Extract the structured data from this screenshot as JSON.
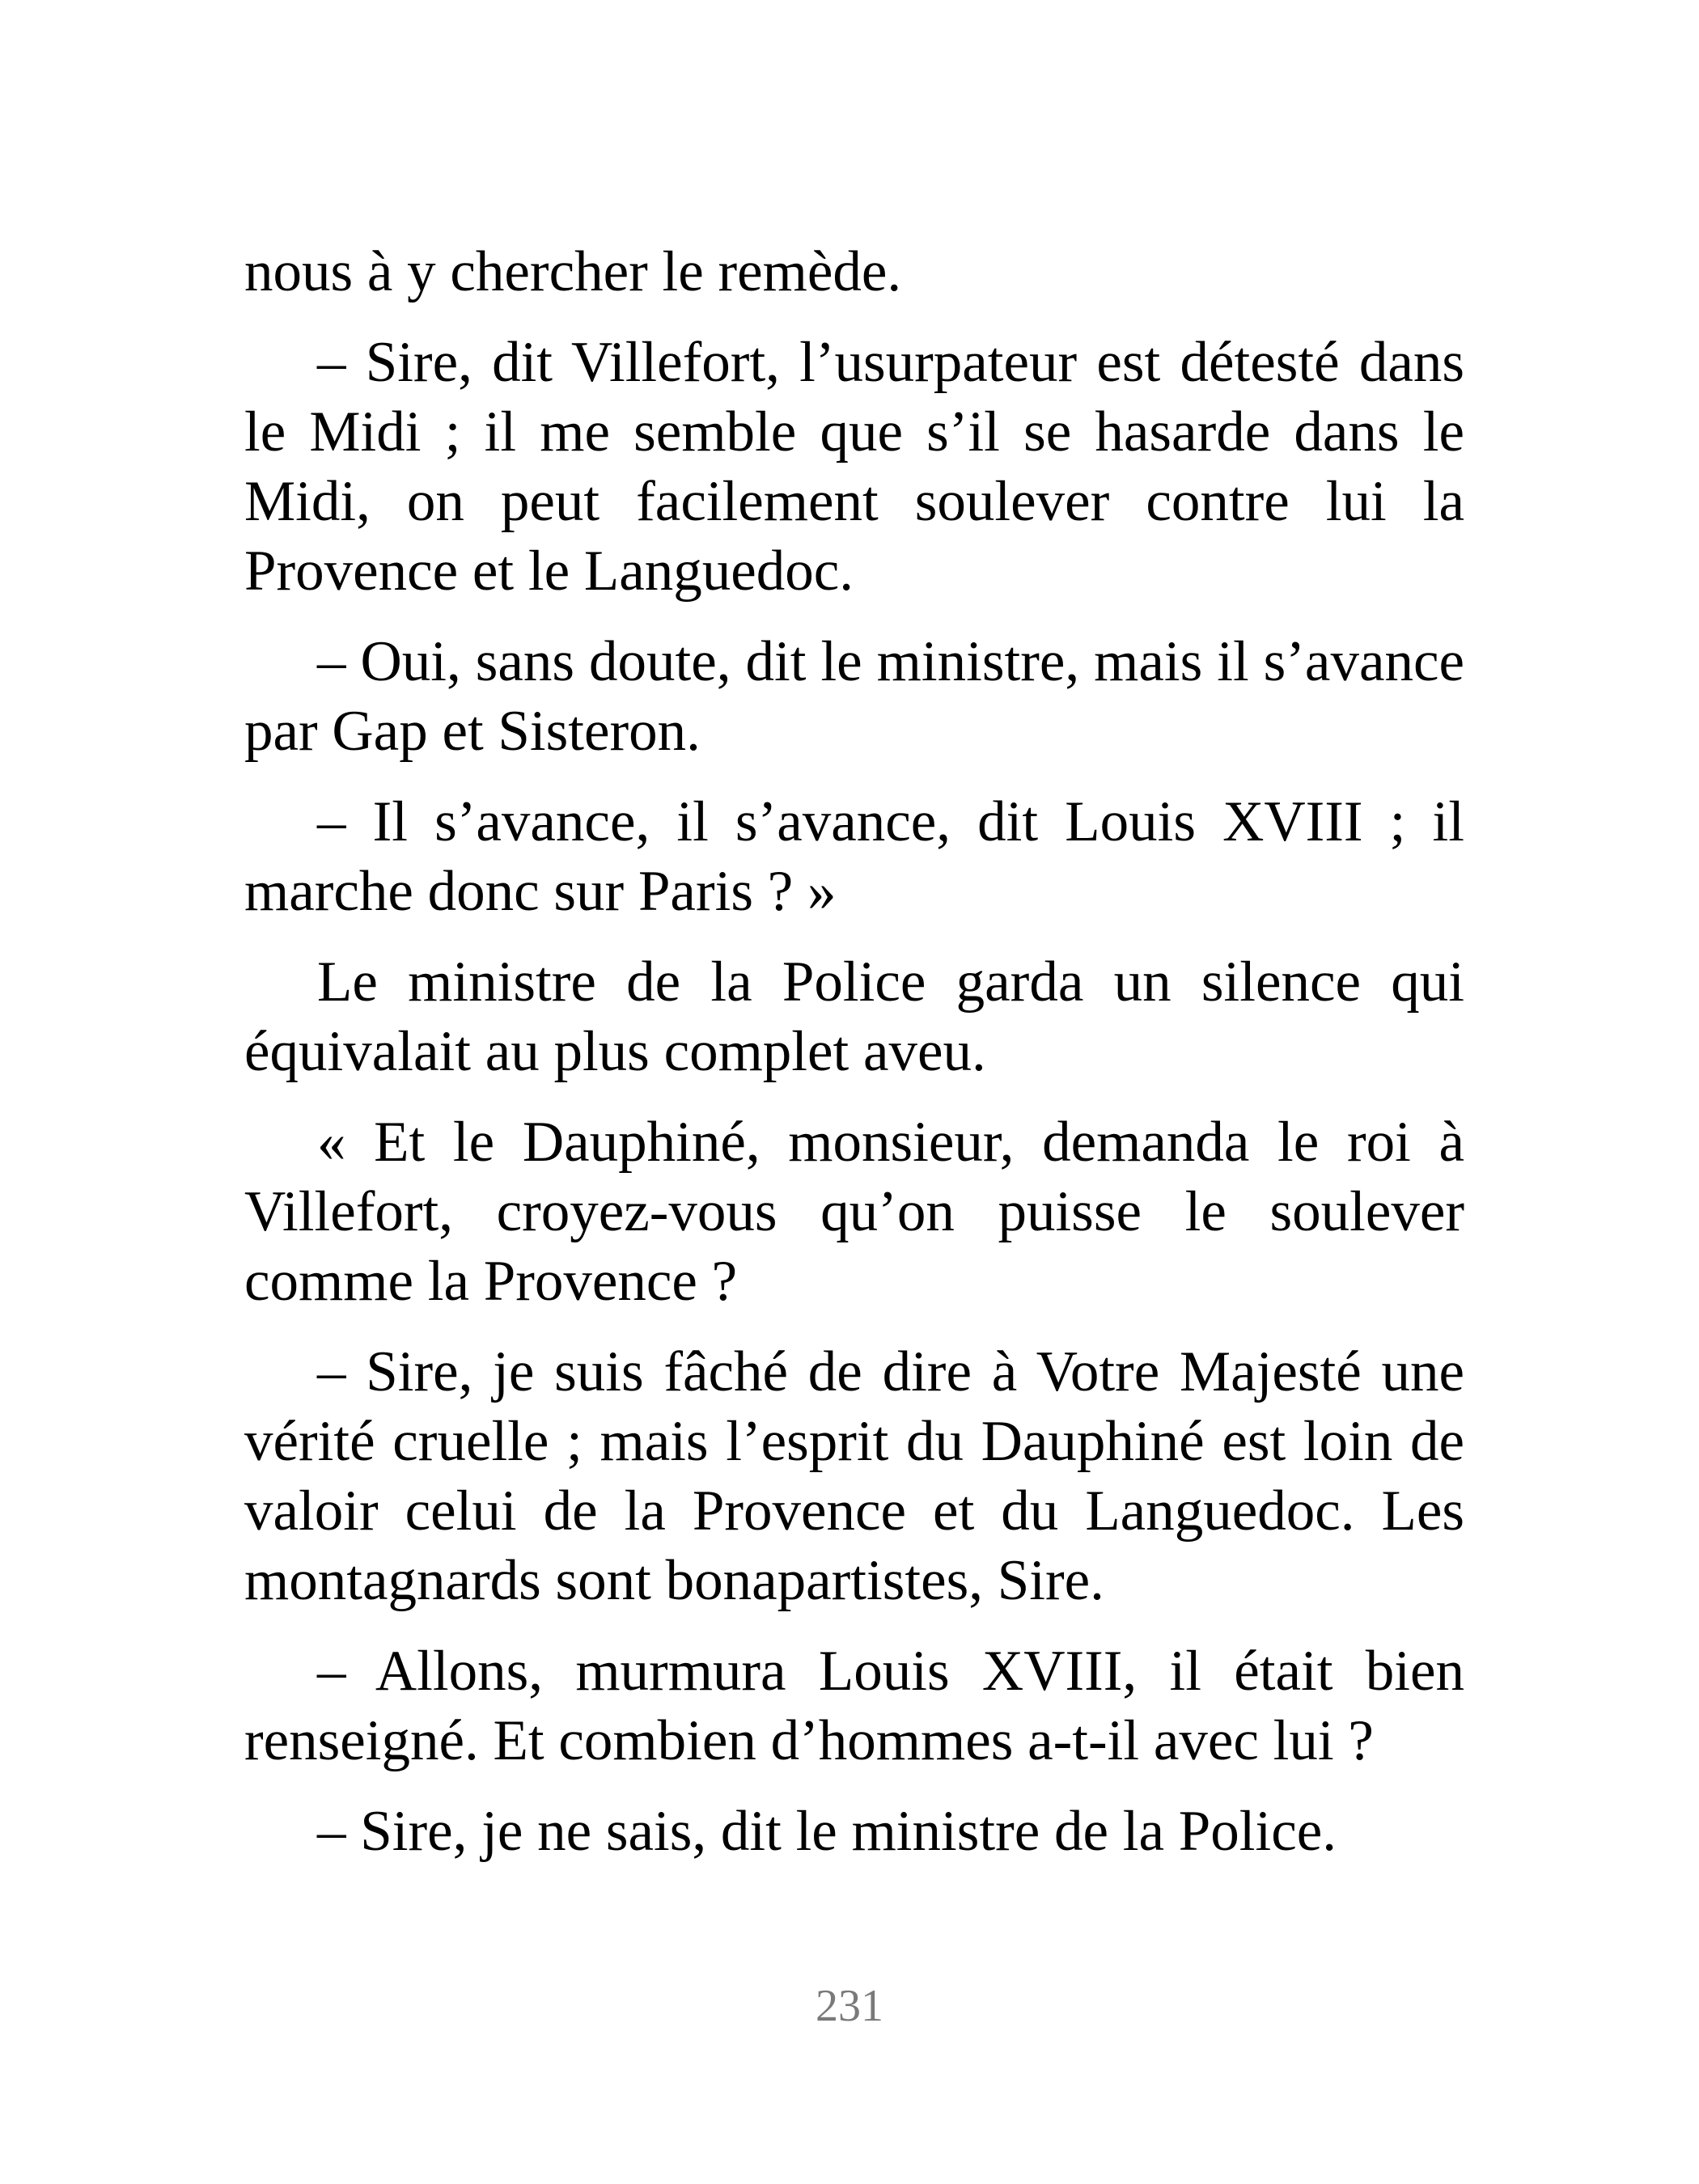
{
  "paragraphs": [
    "nous à y chercher le remède.",
    "– Sire, dit Villefort, l’usurpateur est détesté dans le Midi ; il me semble que s’il se hasarde dans le Midi, on peut facilement soulever contre lui la Provence et le Languedoc.",
    "– Oui, sans doute, dit le ministre, mais il s’avance par Gap et Sisteron.",
    "– Il s’avance, il s’avance, dit Louis XVIII ; il marche donc sur Paris ? »",
    "Le ministre de la Police garda un silence qui équivalait au plus complet aveu.",
    "« Et le Dauphiné, monsieur, demanda le roi à Villefort, croyez-vous qu’on puisse le soulever comme la Provence ?",
    "– Sire, je suis fâché de dire à Votre Majesté une vérité cruelle ; mais l’esprit du Dauphiné est loin de valoir celui de la Provence et du Languedoc. Les montagnards sont bonapartistes, Sire.",
    "– Allons, murmura Louis XVIII, il était bien renseigné. Et combien d’hommes a-t-il avec lui ?",
    "– Sire, je ne sais, dit le ministre de la Police."
  ],
  "page_number": "231"
}
